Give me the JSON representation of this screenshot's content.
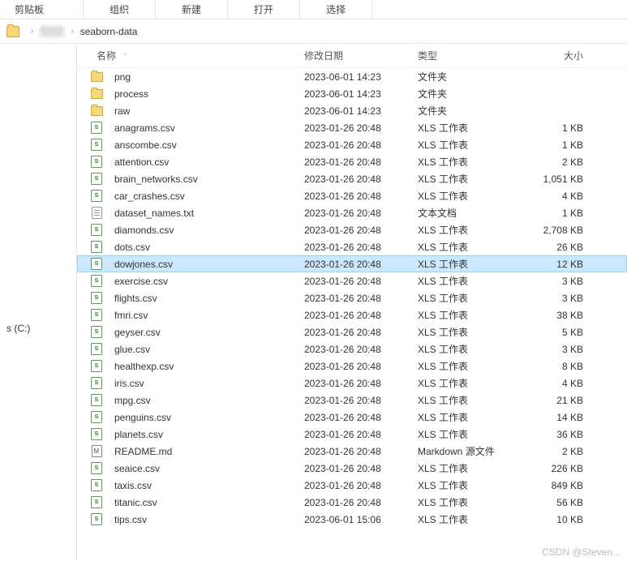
{
  "ribbon": {
    "items": [
      "剪贴板",
      "组织",
      "新建",
      "打开",
      "选择"
    ]
  },
  "breadcrumb": {
    "folder": "seaborn-data"
  },
  "sidebar": {
    "drive": "s (C:)"
  },
  "columns": {
    "name": "名称",
    "date": "修改日期",
    "type": "类型",
    "size": "大小"
  },
  "files": [
    {
      "icon": "folder",
      "name": "png",
      "date": "2023-06-01 14:23",
      "type": "文件夹",
      "size": "",
      "selected": false
    },
    {
      "icon": "folder",
      "name": "process",
      "date": "2023-06-01 14:23",
      "type": "文件夹",
      "size": "",
      "selected": false
    },
    {
      "icon": "folder",
      "name": "raw",
      "date": "2023-06-01 14:23",
      "type": "文件夹",
      "size": "",
      "selected": false
    },
    {
      "icon": "xls",
      "name": "anagrams.csv",
      "date": "2023-01-26 20:48",
      "type": "XLS 工作表",
      "size": "1 KB",
      "selected": false
    },
    {
      "icon": "xls",
      "name": "anscombe.csv",
      "date": "2023-01-26 20:48",
      "type": "XLS 工作表",
      "size": "1 KB",
      "selected": false
    },
    {
      "icon": "xls",
      "name": "attention.csv",
      "date": "2023-01-26 20:48",
      "type": "XLS 工作表",
      "size": "2 KB",
      "selected": false
    },
    {
      "icon": "xls",
      "name": "brain_networks.csv",
      "date": "2023-01-26 20:48",
      "type": "XLS 工作表",
      "size": "1,051 KB",
      "selected": false
    },
    {
      "icon": "xls",
      "name": "car_crashes.csv",
      "date": "2023-01-26 20:48",
      "type": "XLS 工作表",
      "size": "4 KB",
      "selected": false
    },
    {
      "icon": "txt",
      "name": "dataset_names.txt",
      "date": "2023-01-26 20:48",
      "type": "文本文档",
      "size": "1 KB",
      "selected": false
    },
    {
      "icon": "xls",
      "name": "diamonds.csv",
      "date": "2023-01-26 20:48",
      "type": "XLS 工作表",
      "size": "2,708 KB",
      "selected": false
    },
    {
      "icon": "xls",
      "name": "dots.csv",
      "date": "2023-01-26 20:48",
      "type": "XLS 工作表",
      "size": "26 KB",
      "selected": false
    },
    {
      "icon": "xls",
      "name": "dowjones.csv",
      "date": "2023-01-26 20:48",
      "type": "XLS 工作表",
      "size": "12 KB",
      "selected": true
    },
    {
      "icon": "xls",
      "name": "exercise.csv",
      "date": "2023-01-26 20:48",
      "type": "XLS 工作表",
      "size": "3 KB",
      "selected": false
    },
    {
      "icon": "xls",
      "name": "flights.csv",
      "date": "2023-01-26 20:48",
      "type": "XLS 工作表",
      "size": "3 KB",
      "selected": false
    },
    {
      "icon": "xls",
      "name": "fmri.csv",
      "date": "2023-01-26 20:48",
      "type": "XLS 工作表",
      "size": "38 KB",
      "selected": false
    },
    {
      "icon": "xls",
      "name": "geyser.csv",
      "date": "2023-01-26 20:48",
      "type": "XLS 工作表",
      "size": "5 KB",
      "selected": false
    },
    {
      "icon": "xls",
      "name": "glue.csv",
      "date": "2023-01-26 20:48",
      "type": "XLS 工作表",
      "size": "3 KB",
      "selected": false
    },
    {
      "icon": "xls",
      "name": "healthexp.csv",
      "date": "2023-01-26 20:48",
      "type": "XLS 工作表",
      "size": "8 KB",
      "selected": false
    },
    {
      "icon": "xls",
      "name": "iris.csv",
      "date": "2023-01-26 20:48",
      "type": "XLS 工作表",
      "size": "4 KB",
      "selected": false
    },
    {
      "icon": "xls",
      "name": "mpg.csv",
      "date": "2023-01-26 20:48",
      "type": "XLS 工作表",
      "size": "21 KB",
      "selected": false
    },
    {
      "icon": "xls",
      "name": "penguins.csv",
      "date": "2023-01-26 20:48",
      "type": "XLS 工作表",
      "size": "14 KB",
      "selected": false
    },
    {
      "icon": "xls",
      "name": "planets.csv",
      "date": "2023-01-26 20:48",
      "type": "XLS 工作表",
      "size": "36 KB",
      "selected": false
    },
    {
      "icon": "md",
      "name": "README.md",
      "date": "2023-01-26 20:48",
      "type": "Markdown 源文件",
      "size": "2 KB",
      "selected": false
    },
    {
      "icon": "xls",
      "name": "seaice.csv",
      "date": "2023-01-26 20:48",
      "type": "XLS 工作表",
      "size": "226 KB",
      "selected": false
    },
    {
      "icon": "xls",
      "name": "taxis.csv",
      "date": "2023-01-26 20:48",
      "type": "XLS 工作表",
      "size": "849 KB",
      "selected": false
    },
    {
      "icon": "xls",
      "name": "titanic.csv",
      "date": "2023-01-26 20:48",
      "type": "XLS 工作表",
      "size": "56 KB",
      "selected": false
    },
    {
      "icon": "xls",
      "name": "tips.csv",
      "date": "2023-06-01 15:06",
      "type": "XLS 工作表",
      "size": "10 KB",
      "selected": false
    }
  ],
  "watermark": "CSDN @Steven..."
}
